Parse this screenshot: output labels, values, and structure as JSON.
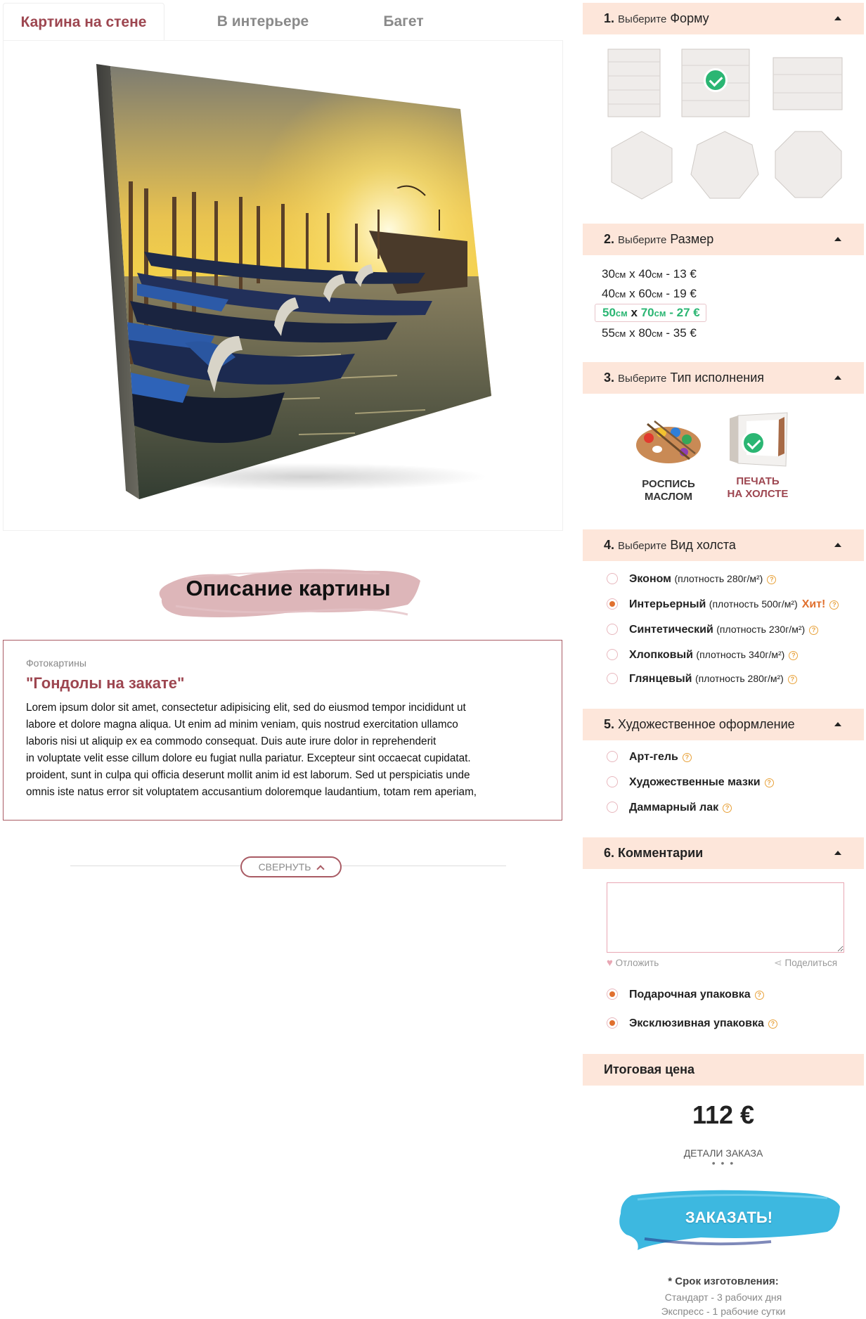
{
  "tabs": [
    "Картина на стене",
    "В интерьере",
    "Багет"
  ],
  "description": {
    "banner": "Описание картины",
    "category": "Фотокартины",
    "title": "\"Гондолы на закате\"",
    "lines": [
      "Lorem ipsum dolor sit amet, consectetur adipisicing elit, sed do eiusmod tempor incididunt ut",
      "labore et dolore magna aliqua. Ut enim ad minim veniam, quis nostrud exercitation ullamco",
      "laboris nisi ut aliquip ex ea commodo consequat. Duis aute irure dolor in reprehenderit",
      "in voluptate velit esse cillum dolore eu fugiat nulla pariatur. Excepteur sint occaecat cupidatat.",
      "proident, sunt in culpa qui officia deserunt mollit anim id est laborum. Sed ut perspiciatis unde",
      "omnis iste natus error sit voluptatem accusantium doloremque laudantium, totam rem aperiam,"
    ],
    "collapse": "СВЕРНУТЬ"
  },
  "sections": {
    "shape": {
      "num": "1.",
      "pre": "Выберите",
      "name": "Форму"
    },
    "size": {
      "num": "2.",
      "pre": "Выберите",
      "name": "Размер"
    },
    "type": {
      "num": "3.",
      "pre": "Выберите",
      "name": "Тип исполнения"
    },
    "canvas": {
      "num": "4.",
      "pre": "Выберите",
      "name": "Вид холста"
    },
    "art": {
      "num": "5.",
      "name": "Художественное оформление"
    },
    "comment": {
      "num": "6.",
      "name": "Комментарии"
    },
    "total": {
      "name": "Итоговая цена"
    }
  },
  "sizes": [
    {
      "w": "30",
      "h": "40",
      "unit": "см",
      "x": "x",
      "price": "13 €"
    },
    {
      "w": "40",
      "h": "60",
      "unit": "см",
      "x": "x",
      "price": "19 €"
    },
    {
      "w": "50",
      "h": "70",
      "unit": "см",
      "x": "x",
      "price": "27 €"
    },
    {
      "w": "55",
      "h": "80",
      "unit": "см",
      "x": "x",
      "price": "35 €"
    }
  ],
  "types": [
    {
      "line1": "РОСПИСЬ",
      "line2": "МАСЛОМ"
    },
    {
      "line1": "ПЕЧАТЬ",
      "line2": "НА ХОЛСТЕ"
    }
  ],
  "canvases": [
    {
      "name": "Эконом",
      "density": "(плотность 280г/м²)"
    },
    {
      "name": "Интерьерный",
      "density": "(плотность 500г/м²)",
      "badge": "Хит!"
    },
    {
      "name": "Синтетический",
      "density": "(плотность 230г/м²)"
    },
    {
      "name": "Хлопковый",
      "density": "(плотность 340г/м²)"
    },
    {
      "name": "Глянцевый",
      "density": "(плотность 280г/м²)"
    }
  ],
  "art_options": [
    "Арт-гель",
    "Художественные мазки",
    "Даммарный лак"
  ],
  "comment_links": {
    "save": "Отложить",
    "share": "Поделиться"
  },
  "packaging": [
    "Подарочная упаковка",
    "Эксклюзивная упаковка"
  ],
  "help_mark": "?",
  "total": {
    "price": "112 €",
    "details": "ДЕТАЛИ ЗАКАЗА",
    "dots": "• • •",
    "order": "ЗАКАЗАТЬ!"
  },
  "production": {
    "title": "* Срок изготовления:",
    "standard": "Стандарт - 3 рабочих дня",
    "express": "Экспресс - 1 рабочие сутки"
  },
  "colors": {
    "accent": "#9d4650",
    "selected": "#2bb673",
    "header_bg": "#fde6da",
    "radio": "#e0702f",
    "order": "#3db8e0"
  }
}
